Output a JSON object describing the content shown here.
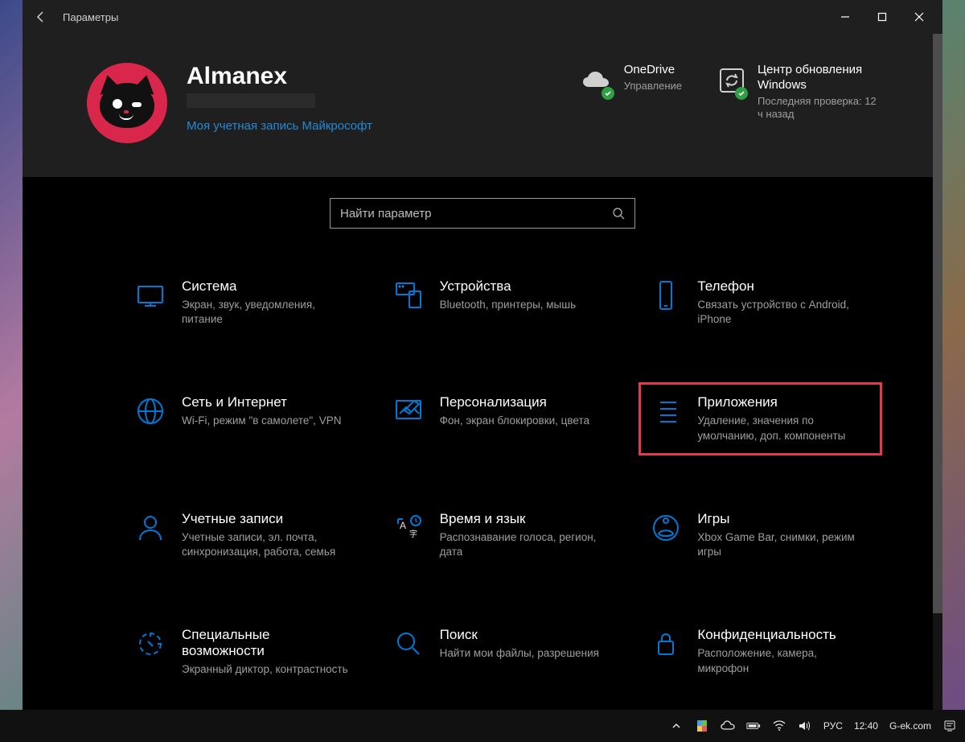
{
  "window": {
    "title": "Параметры"
  },
  "user": {
    "name": "Almanex",
    "link": "Моя учетная запись Майкрософт"
  },
  "status": {
    "onedrive": {
      "title": "OneDrive",
      "sub": "Управление"
    },
    "update": {
      "title": "Центр обновления Windows",
      "sub": "Последняя проверка: 12 ч назад"
    }
  },
  "search": {
    "placeholder": "Найти параметр"
  },
  "categories": [
    {
      "id": "system",
      "title": "Система",
      "desc": "Экран, звук, уведомления, питание"
    },
    {
      "id": "devices",
      "title": "Устройства",
      "desc": "Bluetooth, принтеры, мышь"
    },
    {
      "id": "phone",
      "title": "Телефон",
      "desc": "Связать устройство с Android, iPhone"
    },
    {
      "id": "network",
      "title": "Сеть и Интернет",
      "desc": "Wi-Fi, режим \"в самолете\", VPN"
    },
    {
      "id": "personalization",
      "title": "Персонализация",
      "desc": "Фон, экран блокировки, цвета"
    },
    {
      "id": "apps",
      "title": "Приложения",
      "desc": "Удаление, значения по умолчанию, доп. компоненты",
      "highlight": true
    },
    {
      "id": "accounts",
      "title": "Учетные записи",
      "desc": "Учетные записи, эл. почта, синхронизация, работа, семья"
    },
    {
      "id": "time",
      "title": "Время и язык",
      "desc": "Распознавание голоса, регион, дата"
    },
    {
      "id": "gaming",
      "title": "Игры",
      "desc": "Xbox Game Bar, снимки, режим игры"
    },
    {
      "id": "access",
      "title": "Специальные возможности",
      "desc": "Экранный диктор, контрастность"
    },
    {
      "id": "search",
      "title": "Поиск",
      "desc": "Найти мои файлы, разрешения"
    },
    {
      "id": "privacy",
      "title": "Конфиденциальность",
      "desc": "Расположение, камера, микрофон"
    }
  ],
  "taskbar": {
    "lang": "РУС",
    "time": "12:40",
    "site": "G-ek.com"
  },
  "colors": {
    "accent": "#0078d4",
    "link": "#2489d6",
    "success": "#2ea043",
    "highlight": "#e03a4f"
  }
}
